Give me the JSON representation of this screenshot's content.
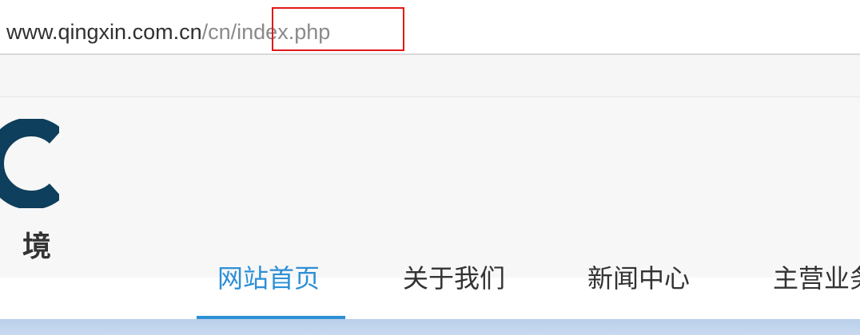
{
  "browser": {
    "url": {
      "host": "www.qingxin.com.cn",
      "path_dir": "/cn",
      "path_file": "/index.php"
    }
  },
  "header": {
    "logo_icon": "c-logo-icon",
    "logo_subtitle": "境"
  },
  "nav": {
    "items": [
      {
        "label": "网站首页",
        "active": true
      },
      {
        "label": "关于我们",
        "active": false
      },
      {
        "label": "新闻中心",
        "active": false
      },
      {
        "label": "主营业务",
        "active": false
      }
    ]
  },
  "colors": {
    "accent": "#2d8fd5",
    "highlight": "#e11919",
    "logo": "#0e3f5c"
  }
}
